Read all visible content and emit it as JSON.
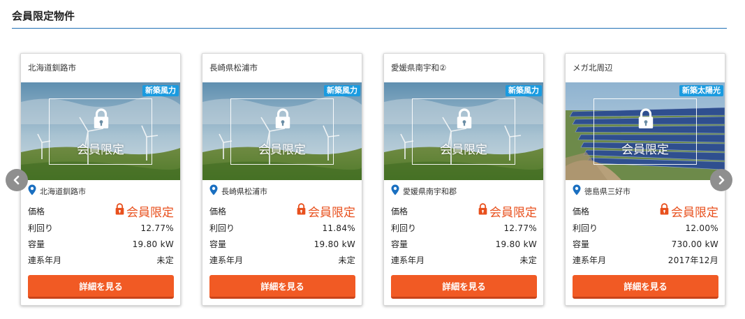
{
  "section": {
    "title": "会員限定物件"
  },
  "cards": [
    {
      "title": "北海道釧路市",
      "badge": "新築風力",
      "image": "wind-turbines",
      "locked_label": "会員限定",
      "location": "北海道釧路市",
      "rows": {
        "price_label": "価格",
        "price_value": "会員限定",
        "yield_label": "利回り",
        "yield_value": "12.77%",
        "capacity_label": "容量",
        "capacity_value": "19.80 kW",
        "date_label": "連系年月",
        "date_value": "未定"
      },
      "button": "詳細を見る"
    },
    {
      "title": "長崎県松浦市",
      "badge": "新築風力",
      "image": "wind-turbines",
      "locked_label": "会員限定",
      "location": "長崎県松浦市",
      "rows": {
        "price_label": "価格",
        "price_value": "会員限定",
        "yield_label": "利回り",
        "yield_value": "11.84%",
        "capacity_label": "容量",
        "capacity_value": "19.80 kW",
        "date_label": "連系年月",
        "date_value": "未定"
      },
      "button": "詳細を見る"
    },
    {
      "title": "愛媛県南宇和②",
      "badge": "新築風力",
      "image": "wind-turbines",
      "locked_label": "会員限定",
      "location": "愛媛県南宇和郡",
      "rows": {
        "price_label": "価格",
        "price_value": "会員限定",
        "yield_label": "利回り",
        "yield_value": "12.77%",
        "capacity_label": "容量",
        "capacity_value": "19.80 kW",
        "date_label": "連系年月",
        "date_value": "未定"
      },
      "button": "詳細を見る"
    },
    {
      "title": "メガ北周辺",
      "badge": "新築太陽光",
      "image": "solar-panels",
      "locked_label": "会員限定",
      "location": "徳島県三好市",
      "rows": {
        "price_label": "価格",
        "price_value": "会員限定",
        "yield_label": "利回り",
        "yield_value": "12.00%",
        "capacity_label": "容量",
        "capacity_value": "730.00 kW",
        "date_label": "連系年月",
        "date_value": "2017年12月"
      },
      "button": "詳細を見る"
    }
  ],
  "colors": {
    "accent": "#f15a24",
    "rule": "#1f6fb5",
    "badge": "#1a9be0",
    "pin": "#1a6fc0",
    "member": "#e8501d"
  },
  "icons": {
    "prev": "chevron-left-icon",
    "next": "chevron-right-icon",
    "pin": "location-pin-icon",
    "lock": "padlock-icon"
  }
}
